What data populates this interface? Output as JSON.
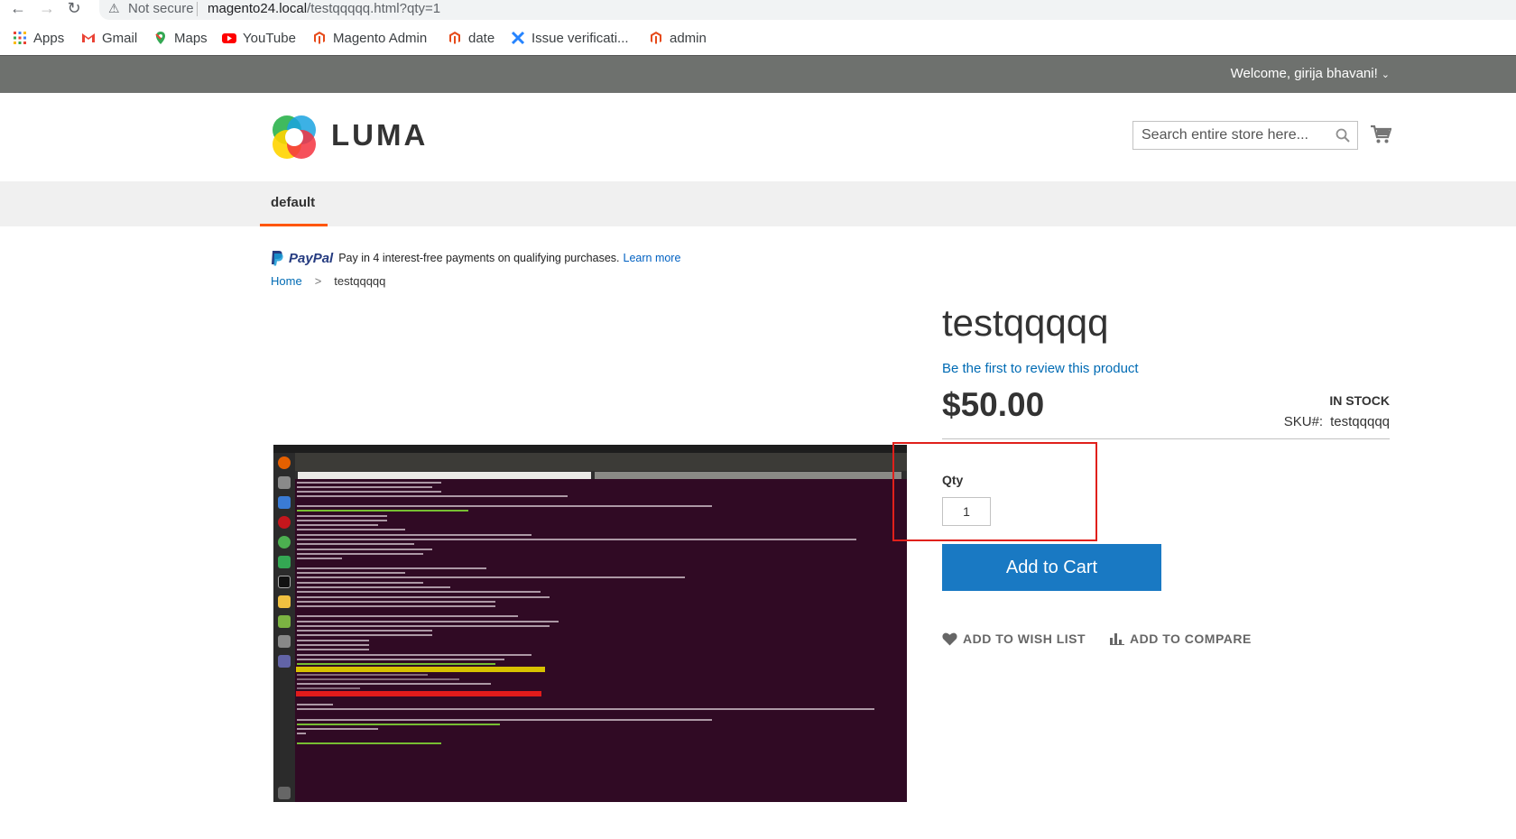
{
  "browser": {
    "security_label": "Not secure",
    "url_host": "magento24.local",
    "url_path": "/testqqqqq.html?qty=1",
    "bookmarks": [
      {
        "label": "Apps",
        "icon": "apps-grid-icon"
      },
      {
        "label": "Gmail",
        "icon": "gmail-icon"
      },
      {
        "label": "Maps",
        "icon": "maps-icon"
      },
      {
        "label": "YouTube",
        "icon": "youtube-icon"
      },
      {
        "label": "Magento Admin",
        "icon": "magento-icon"
      },
      {
        "label": "date",
        "icon": "magento-icon"
      },
      {
        "label": "Issue verificati...",
        "icon": "jira-icon"
      },
      {
        "label": "admin",
        "icon": "magento-icon"
      }
    ]
  },
  "header": {
    "welcome": "Welcome, girija bhavani!",
    "logo_text": "LUMA",
    "search_placeholder": "Search entire store here..."
  },
  "nav": {
    "items": [
      {
        "label": "default"
      }
    ]
  },
  "paypal": {
    "brand": "PayPal",
    "message": "Pay in 4 interest-free payments on qualifying purchases.",
    "link": "Learn more"
  },
  "breadcrumbs": {
    "home": "Home",
    "separator": ">",
    "current": "testqqqqq"
  },
  "product": {
    "title": "testqqqqq",
    "review_link": "Be the first to review this product",
    "price": "$50.00",
    "stock": "IN STOCK",
    "sku_label": "SKU#:",
    "sku": "testqqqqq",
    "qty_label": "Qty",
    "qty_value": "1",
    "add_to_cart": "Add to Cart",
    "wishlist": "ADD TO WISH LIST",
    "compare": "ADD TO COMPARE"
  },
  "colors": {
    "accent": "#1979c3",
    "link": "#006bb4",
    "nav_underline": "#ff5501",
    "panel_bg": "#6e716e",
    "annotation": "#e0201b",
    "terminal_bg": "#300a24"
  }
}
